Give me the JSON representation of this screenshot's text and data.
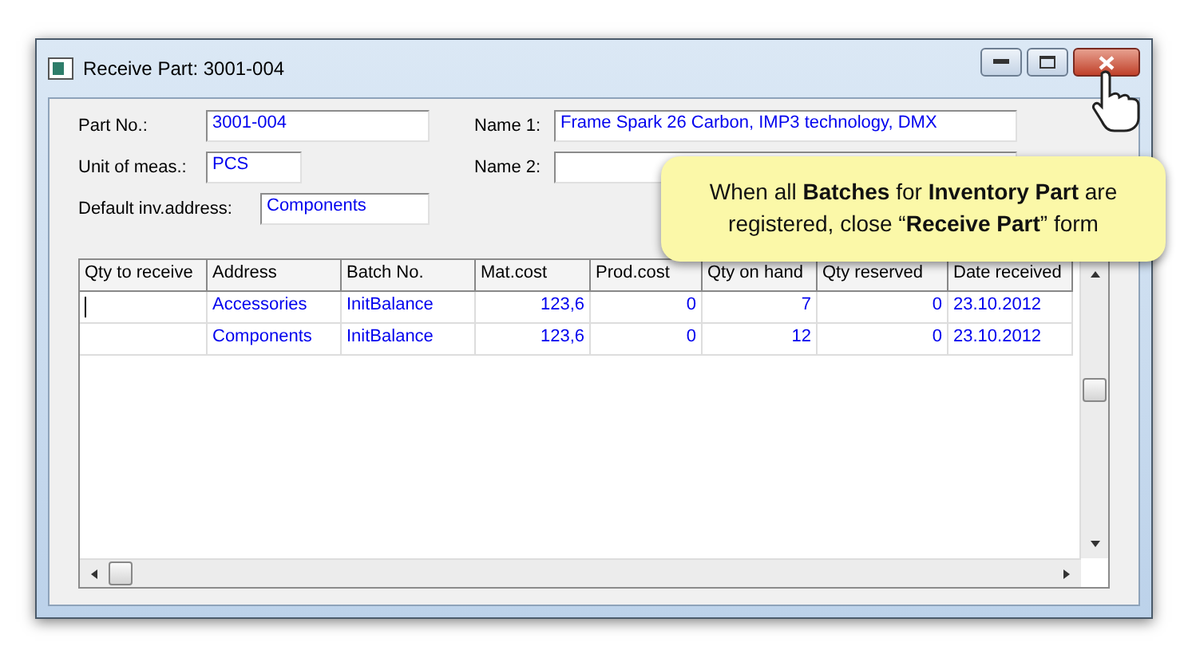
{
  "window": {
    "title": "Receive Part: 3001-004"
  },
  "left_fields": [
    {
      "label": "Part No.:",
      "value": "3001-004"
    },
    {
      "label": "Unit of meas.:",
      "value": "PCS"
    },
    {
      "label": "Default inv.address:",
      "value": "Components"
    }
  ],
  "right_fields": [
    {
      "label": "Name 1:",
      "value": "Frame Spark 26 Carbon, IMP3 technology, DMX"
    },
    {
      "label": "Name 2:"
    }
  ],
  "table": {
    "columns": [
      {
        "label": "Qty to receive",
        "kind": "text"
      },
      {
        "label": "Address",
        "kind": "text"
      },
      {
        "label": "Batch No.",
        "kind": "text"
      },
      {
        "label": "Mat.cost",
        "kind": "number"
      },
      {
        "label": "Prod.cost",
        "kind": "number"
      },
      {
        "label": "Qty on hand",
        "kind": "number"
      },
      {
        "label": "Qty reserved",
        "kind": "number"
      },
      {
        "label": "Date received",
        "kind": "text"
      }
    ],
    "rows": [
      {
        "editing": true,
        "cells": [
          "",
          "Accessories",
          "InitBalance",
          "123,6",
          "0",
          "7",
          "0",
          "23.10.2012"
        ]
      },
      {
        "editing": false,
        "cells": [
          "",
          "Components",
          "InitBalance",
          "123,6",
          "0",
          "12",
          "0",
          "23.10.2012"
        ]
      }
    ]
  },
  "callout": {
    "text": "When all **Batches** for **Inventory Part** are registered, close “**Receive Part**” form"
  }
}
